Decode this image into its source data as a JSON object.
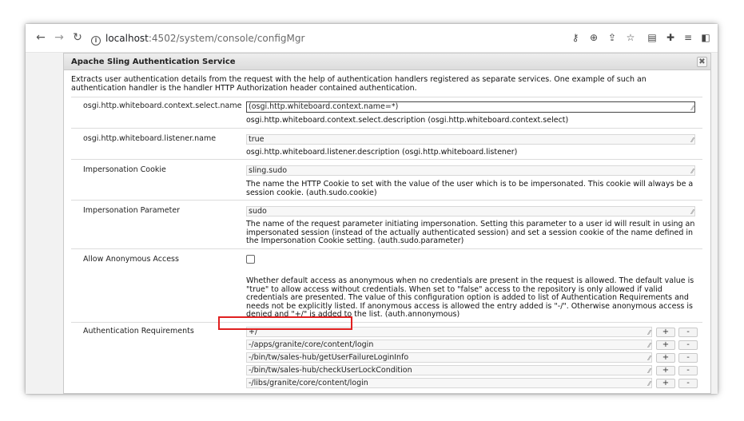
{
  "browser": {
    "url_host": "localhost",
    "url_path": ":4502/system/console/configMgr",
    "icons": [
      "back-icon",
      "forward-icon",
      "reload-icon",
      "info-icon",
      "key-icon",
      "zoom-icon",
      "share-icon",
      "star-icon",
      "reader-icon",
      "extensions-icon",
      "queue-icon",
      "sidepanel-icon"
    ]
  },
  "dialog": {
    "title": "Apache Sling Authentication Service",
    "close_label": "✖",
    "description": "Extracts user authentication details from the request with the help of authentication handlers registered as separate services. One example of such an authentication handler is the handler HTTP Authorization header contained authentication.",
    "fields": [
      {
        "label": "osgi.http.whiteboard.context.select.name",
        "value": "(osgi.http.whiteboard.context.name=*)",
        "hint": "osgi.http.whiteboard.context.select.description (osgi.http.whiteboard.context.select)"
      },
      {
        "label": "osgi.http.whiteboard.listener.name",
        "value": "true",
        "hint": "osgi.http.whiteboard.listener.description (osgi.http.whiteboard.listener)"
      },
      {
        "label": "Impersonation Cookie",
        "value": "sling.sudo",
        "hint": "The name the HTTP Cookie to set with the value of the user which is to be impersonated. This cookie will always be a session cookie. (auth.sudo.cookie)"
      },
      {
        "label": "Impersonation Parameter",
        "value": "sudo",
        "hint": "The name of the request parameter initiating impersonation. Setting this parameter to a user id will result in using an impersonated session (instead of the actually authenticated session) and set a session cookie of the name defined in the Impersonation Cookie setting. (auth.sudo.parameter)"
      },
      {
        "label": "Allow Anonymous Access",
        "checked": false,
        "hint": "Whether default access as anonymous when no credentials are present in the request is allowed. The default value is \"true\" to allow access without credentials. When set to \"false\" access to the repository is only allowed if valid credentials are presented. The value of this configuration option is added to list of Authentication Requirements and needs not be explicitly listed. If anonymous access is allowed the entry added is \"-/\". Otherwise anonymous access is denied and \"+/\" is added to the list. (auth.annonymous)"
      }
    ],
    "auth_requirements": {
      "label": "Authentication Requirements",
      "add_label": "+",
      "remove_label": "-",
      "values": [
        "+/",
        "-/apps/granite/core/content/login",
        "-/bin/tw/sales-hub/getUserFailureLoginInfo",
        "-/bin/tw/sales-hub/checkUserLockCondition",
        "-/libs/granite/core/content/login"
      ],
      "highlighted_index": 1,
      "highlight_color": "#e02020"
    }
  }
}
